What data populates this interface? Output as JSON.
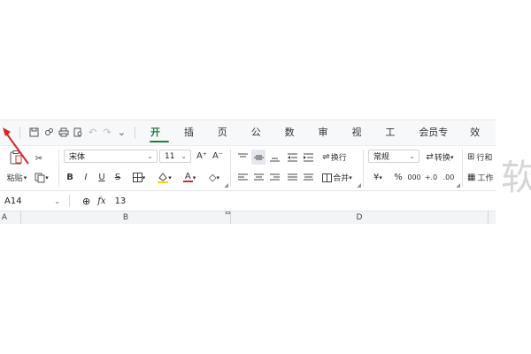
{
  "quick_access": {
    "icons": [
      "chevron-down-icon",
      "save-icon",
      "share-icon",
      "print-icon",
      "print-preview-icon",
      "undo-icon",
      "redo-icon",
      "more-icon"
    ]
  },
  "menu": {
    "tabs": [
      {
        "label": "开始",
        "active": true
      },
      {
        "label": "插入"
      },
      {
        "label": "页面"
      },
      {
        "label": "公式"
      },
      {
        "label": "数据"
      },
      {
        "label": "审阅"
      },
      {
        "label": "视图"
      },
      {
        "label": "工具"
      },
      {
        "label": "会员专享"
      },
      {
        "label": "效率"
      }
    ]
  },
  "ribbon": {
    "paste_label": "粘贴",
    "font_name": "宋体",
    "font_size": "11",
    "bold": "B",
    "italic": "I",
    "underline": "U",
    "strike": "S",
    "font_grow": "A⁺",
    "font_shrink": "A⁻",
    "font_color_letter": "A",
    "wrap_label": "换行",
    "merge_label": "合并",
    "number_format": "常规",
    "convert_label": "转换",
    "currency": "¥",
    "percent": "%",
    "row_col_label": "行和",
    "worksheet_label": "工作",
    "font_color": "#d9262c",
    "fill_color": "#f5d900"
  },
  "formula_bar": {
    "name_box": "A14",
    "fx_label": "fx",
    "value": "13"
  },
  "columns": [
    "A",
    "B",
    "D"
  ],
  "watermark": "软",
  "colors": {
    "accent": "#1e7e45",
    "arrow": "#d9262c"
  }
}
